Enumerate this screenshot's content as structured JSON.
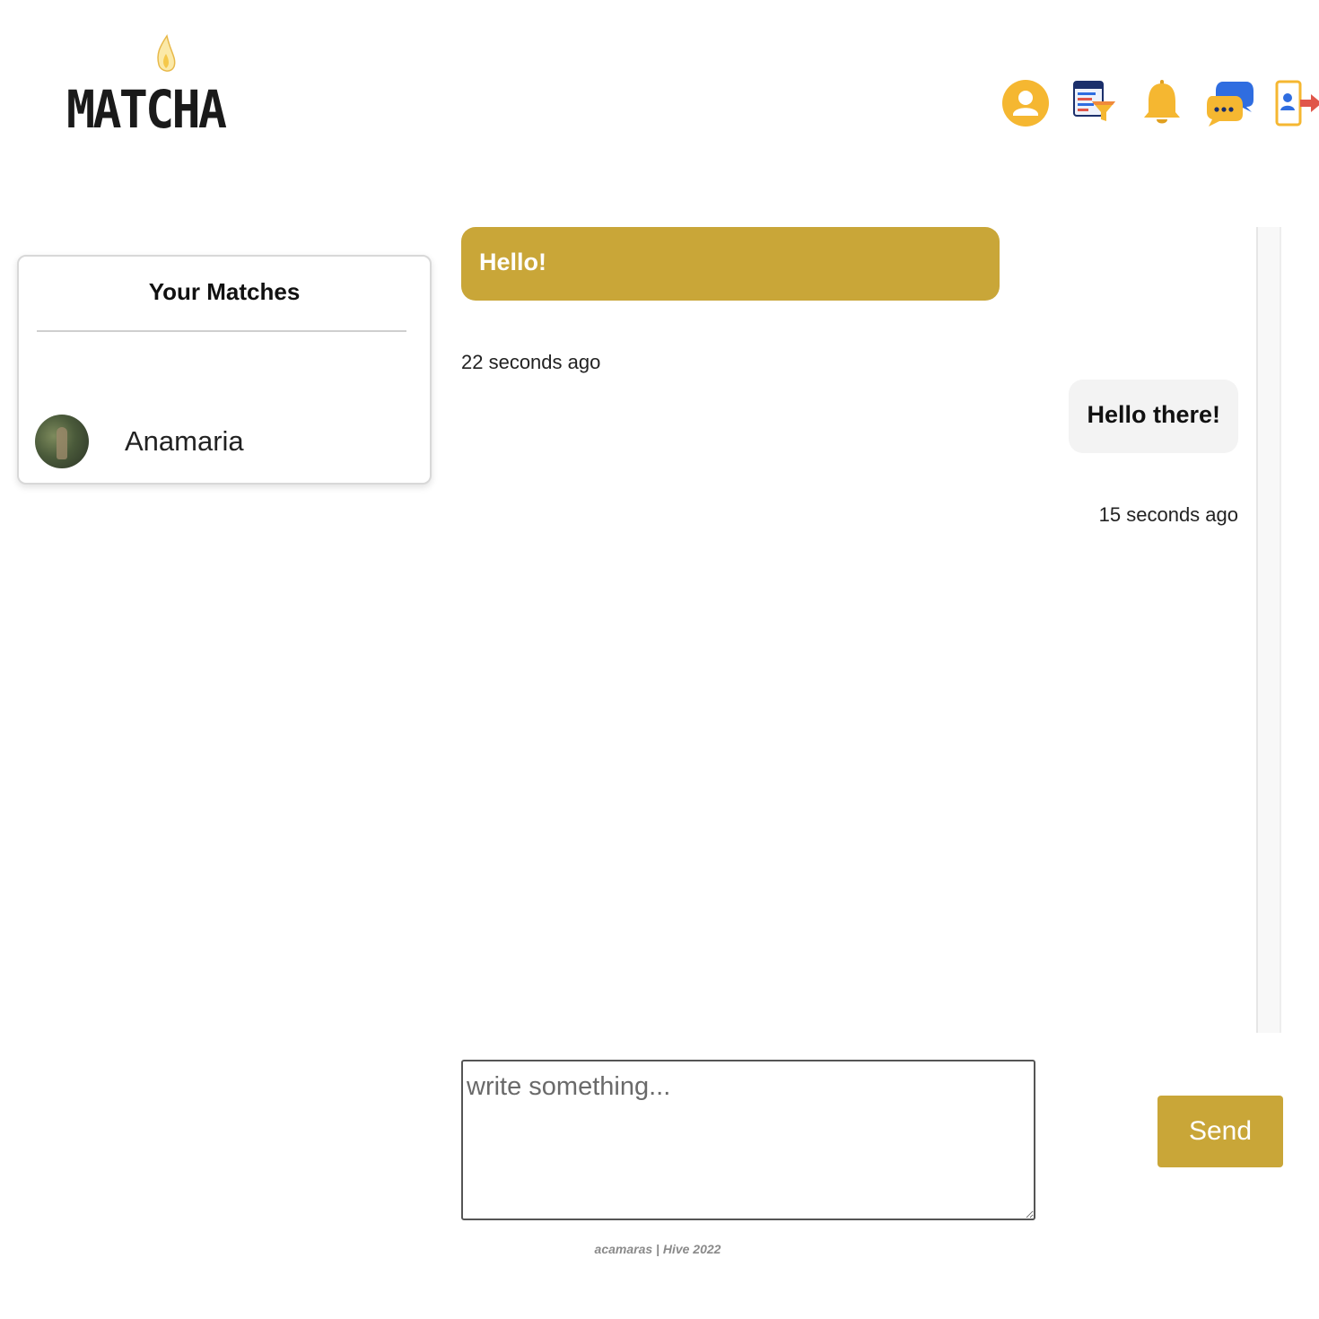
{
  "header": {
    "logo_text": "MATCHA",
    "nav": [
      {
        "icon": "user-profile-icon",
        "label": "Profile"
      },
      {
        "icon": "browse-filter-icon",
        "label": "Browse"
      },
      {
        "icon": "bell-icon",
        "label": "Notifications"
      },
      {
        "icon": "chat-icon",
        "label": "Chat"
      },
      {
        "icon": "logout-icon",
        "label": "Logout"
      }
    ]
  },
  "matches": {
    "title": "Your Matches",
    "items": [
      {
        "name": "Anamaria"
      }
    ]
  },
  "messages": [
    {
      "text": "Hello!",
      "time": "22 seconds ago",
      "side": "left"
    },
    {
      "text": "Hello there!",
      "time": "15 seconds ago",
      "side": "right"
    }
  ],
  "composer": {
    "placeholder": "write something...",
    "send_label": "Send"
  },
  "footer": {
    "text": "acamaras | Hive 2022"
  },
  "colors": {
    "accent": "#c9a638",
    "icon_yellow": "#f5b731",
    "icon_blue": "#2f6de0"
  }
}
